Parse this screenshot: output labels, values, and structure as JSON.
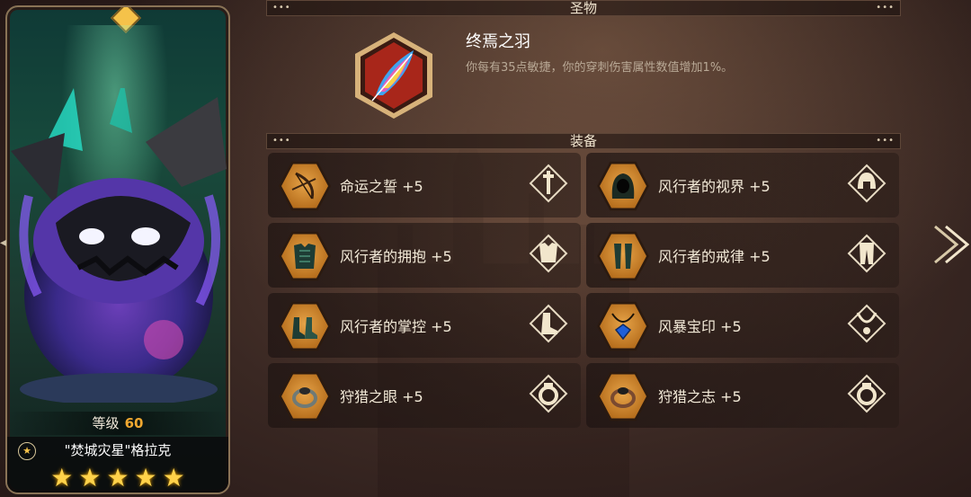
{
  "hero": {
    "level_label": "等级",
    "level_value": "60",
    "name": "\"焚城灾星\"格拉克",
    "stars": [
      "★",
      "★",
      "★",
      "★",
      "★"
    ]
  },
  "sections": {
    "relic_header": "圣物",
    "equip_header": "装备"
  },
  "relic": {
    "icon": "feather-icon",
    "title": "终焉之羽",
    "description": "你每有35点敏捷，你的穿刺伤害属性数值增加1%。"
  },
  "equipment": [
    {
      "label": "命运之誓 +5",
      "icon": "bow-icon",
      "slot": "weapon-slot-icon"
    },
    {
      "label": "风行者的视界 +5",
      "icon": "hood-icon",
      "slot": "helmet-slot-icon"
    },
    {
      "label": "风行者的拥抱 +5",
      "icon": "chest-armor-icon",
      "slot": "armor-slot-icon"
    },
    {
      "label": "风行者的戒律 +5",
      "icon": "leg-armor-icon",
      "slot": "legs-slot-icon"
    },
    {
      "label": "风行者的掌控 +5",
      "icon": "boots-icon",
      "slot": "boots-slot-icon"
    },
    {
      "label": "风暴宝印 +5",
      "icon": "amulet-icon",
      "slot": "necklace-slot-icon"
    },
    {
      "label": "狩猎之眼 +5",
      "icon": "ring-icon",
      "slot": "ring-slot-icon"
    },
    {
      "label": "狩猎之志 +5",
      "icon": "ring-icon",
      "slot": "ring-slot-icon"
    }
  ],
  "colors": {
    "accent_gold": "#f5c24a",
    "level_orange": "#f0a830",
    "icon_orange": "#d08a30",
    "relic_red": "#a8261a"
  },
  "nav": {
    "right_arrow": "chevron-right-icon",
    "left_arrow": "chevron-left-icon"
  }
}
